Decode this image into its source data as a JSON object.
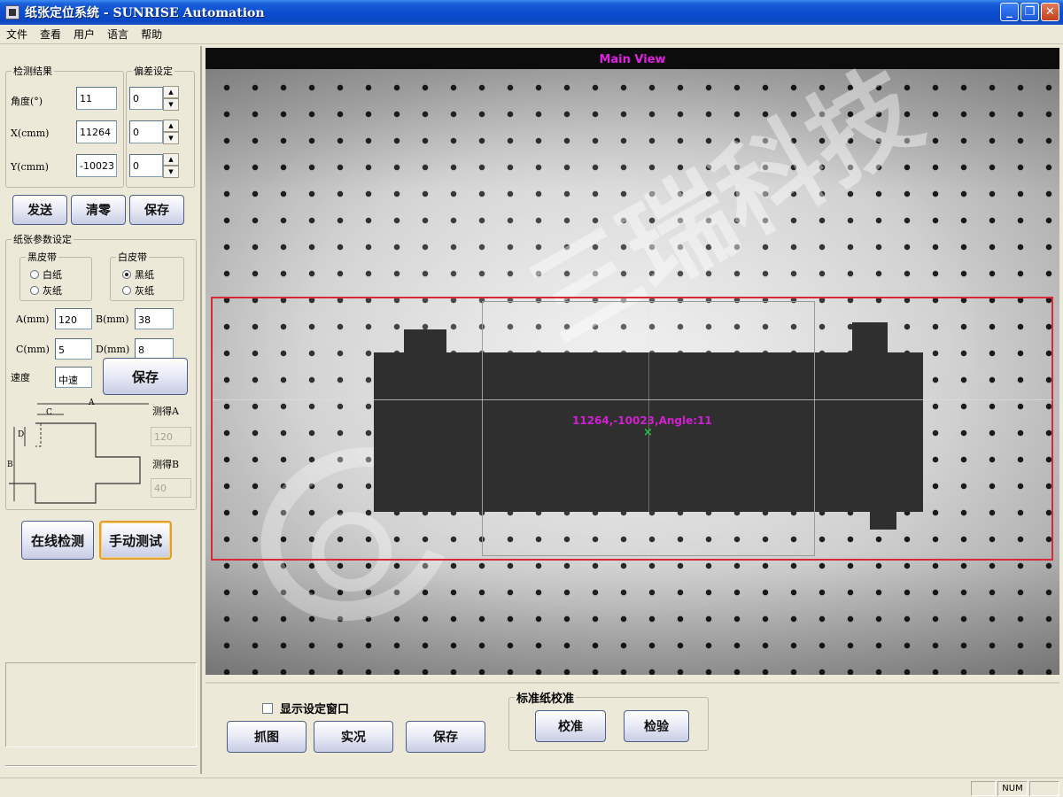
{
  "window": {
    "title": "纸张定位系统 - SUNRISE Automation",
    "minimize": "_",
    "restore": "❐",
    "close": "✕"
  },
  "menu": [
    "文件",
    "查看",
    "用户",
    "语言",
    "帮助"
  ],
  "detection": {
    "legend": "检测结果",
    "angle_label": "角度(°)",
    "x_label": "X(cmm)",
    "y_label": "Y(cmm)",
    "angle_value": "11",
    "x_value": "11264",
    "y_value": "-10023"
  },
  "offset": {
    "legend": "偏差设定",
    "angle": "0",
    "x": "0",
    "y": "0"
  },
  "result_buttons": {
    "send": "发送",
    "clear": "清零",
    "save": "保存"
  },
  "paper_params": {
    "legend": "纸张参数设定",
    "black_belt": {
      "legend": "黑皮带",
      "option1": "白纸",
      "option2": "灰纸"
    },
    "white_belt": {
      "legend": "白皮带",
      "option1": "黑纸",
      "option2": "灰纸"
    },
    "a_label": "A(mm)",
    "a_value": "120",
    "b_label": "B(mm)",
    "b_value": "38",
    "c_label": "C(mm)",
    "c_value": "5",
    "d_label": "D(mm)",
    "d_value": "8",
    "speed_label": "速度",
    "speed_value": "中速",
    "save": "保存",
    "measured_a_label": "测得A",
    "measured_a_value": "120",
    "measured_b_label": "测得B",
    "measured_b_value": "40",
    "diagram": {
      "a": "A",
      "b": "B",
      "c": "C",
      "d": "D"
    }
  },
  "mode_buttons": {
    "online": "在线检测",
    "manual": "手动测试"
  },
  "main_view": {
    "title": "Main View",
    "readout": "11264,-10023,Angle:11",
    "center_mark": "×",
    "watermark": "三瑞科技"
  },
  "bottom": {
    "show_settings": "显示设定窗口",
    "capture": "抓图",
    "live": "实况",
    "save": "保存",
    "calib_legend": "标准纸校准",
    "calibrate": "校准",
    "verify": "检验"
  },
  "status": {
    "num": "NUM"
  }
}
